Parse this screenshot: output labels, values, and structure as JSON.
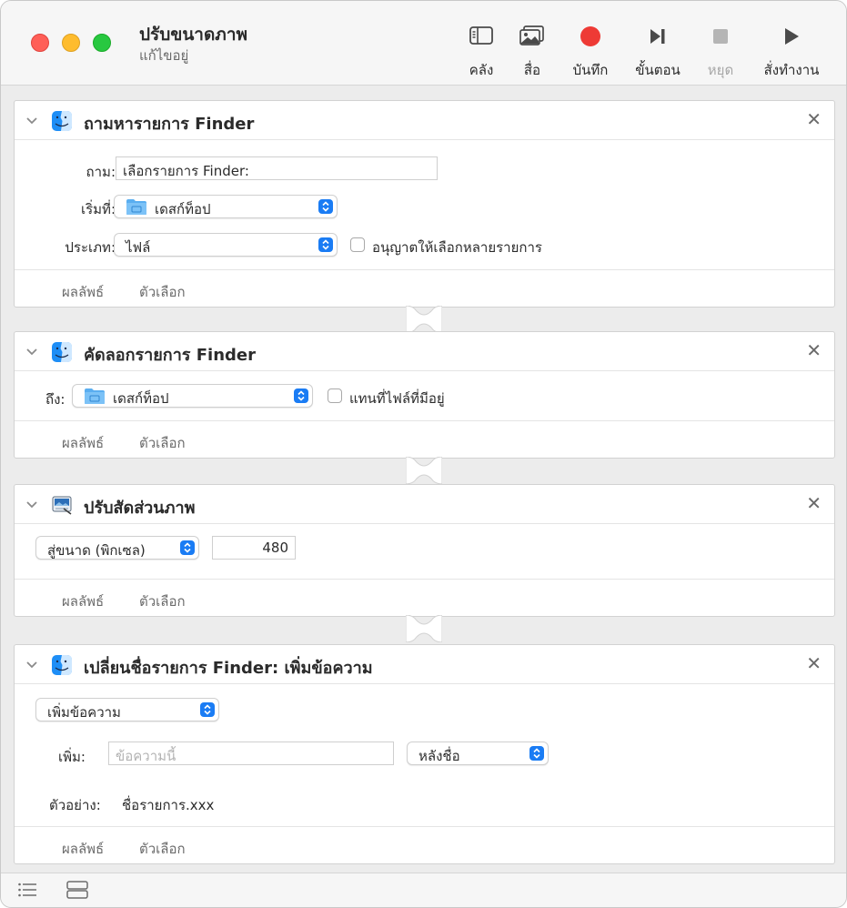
{
  "window": {
    "title": "ปรับขนาดภาพ",
    "subtitle": "แก้ไขอยู่"
  },
  "toolbar": {
    "library_label": "คลัง",
    "media_label": "สื่อ",
    "record_label": "บันทึก",
    "step_label": "ขั้นตอน",
    "stop_label": "หยุด",
    "run_label": "สั่งทำงาน"
  },
  "actions": [
    {
      "title": "ถามหารายการ Finder",
      "prompt_label": "ถาม:",
      "prompt_value": "เลือกรายการ Finder:",
      "start_label": "เริ่มที่:",
      "start_value": "เดสก์ท็อป",
      "type_label": "ประเภท:",
      "type_value": "ไฟล์",
      "allow_multiple_label": "อนุญาตให้เลือกหลายรายการ",
      "results_tab": "ผลลัพธ์",
      "options_tab": "ตัวเลือก"
    },
    {
      "title": "คัดลอกรายการ Finder",
      "to_label": "ถึง:",
      "to_value": "เดสก์ท็อป",
      "replace_label": "แทนที่ไฟล์ที่มีอยู่",
      "results_tab": "ผลลัพธ์",
      "options_tab": "ตัวเลือก"
    },
    {
      "title": "ปรับสัดส่วนภาพ",
      "mode_value": "สู่ขนาด (พิกเซล)",
      "size_value": "480",
      "results_tab": "ผลลัพธ์",
      "options_tab": "ตัวเลือก"
    },
    {
      "title": "เปลี่ยนชื่อรายการ Finder: เพิ่มข้อความ",
      "mode_value": "เพิ่มข้อความ",
      "add_label": "เพิ่ม:",
      "add_placeholder": "ข้อความนี้",
      "position_value": "หลังชื่อ",
      "example_label": "ตัวอย่าง:",
      "example_value": "ชื่อรายการ.xxx",
      "results_tab": "ผลลัพธ์",
      "options_tab": "ตัวเลือก"
    }
  ],
  "colors": {
    "accent": "#1a7cf4",
    "record": "#ee3a35"
  }
}
